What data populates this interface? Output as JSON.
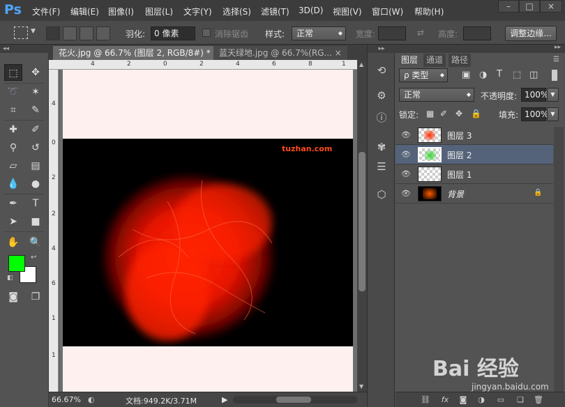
{
  "app": {
    "logo": "Ps"
  },
  "menu": [
    "文件(F)",
    "编辑(E)",
    "图像(I)",
    "图层(L)",
    "文字(Y)",
    "选择(S)",
    "滤镜(T)",
    "3D(D)",
    "视图(V)",
    "窗口(W)",
    "帮助(H)"
  ],
  "window_controls": [
    "–",
    "□",
    "×"
  ],
  "options": {
    "feather_label": "羽化:",
    "feather_value": "0 像素",
    "antialias_label": "消除锯齿",
    "style_label": "样式:",
    "style_value": "正常",
    "width_label": "宽度:",
    "height_label": "高度:",
    "refine_edge": "调整边缘..."
  },
  "document": {
    "tabs": [
      {
        "label": "花火.jpg @ 66.7% (图层 2, RGB/8#) *",
        "close": "×"
      },
      {
        "label": "蓝天绿地.jpg @ 66.7%(RG...",
        "close": "×"
      }
    ],
    "ruler_top_ticks": [
      "4",
      "2",
      "0",
      "2",
      "4",
      "6",
      "8",
      "1",
      "0",
      "1",
      "2",
      "1",
      "4"
    ],
    "ruler_left_ticks": [
      "4",
      "2",
      "0",
      "2",
      "4",
      "6",
      "8",
      "1",
      "0",
      "1",
      "2",
      "1",
      "4"
    ],
    "watermark": "tuzhan.com"
  },
  "status": {
    "zoom": "66.67%",
    "doc_info": "文档:949.2K/3.71M"
  },
  "colors": {
    "foreground": "#00ff00",
    "background": "#ffffff",
    "selection": "#54637a",
    "logo": "#4fa6ff"
  },
  "layers_panel": {
    "tabs": [
      "图层",
      "通道",
      "路径"
    ],
    "filter_label": "ρ 类型",
    "blend_mode": "正常",
    "opacity_label": "不透明度:",
    "opacity_value": "100%",
    "lock_label": "锁定:",
    "fill_label": "填充:",
    "fill_value": "100%",
    "layers": [
      {
        "name": "图层 3",
        "selected": false
      },
      {
        "name": "图层 2",
        "selected": true
      },
      {
        "name": "图层 1",
        "selected": false
      },
      {
        "name": "背景",
        "selected": false,
        "locked": true
      }
    ],
    "bottom_icons": [
      "link-icon",
      "fx-icon",
      "mask-icon",
      "adjustment-icon",
      "folder-icon",
      "new-layer-icon",
      "trash-icon"
    ]
  },
  "watermark_overlay": {
    "brand": "Bai 经验",
    "url": "jingyan.baidu.com"
  }
}
